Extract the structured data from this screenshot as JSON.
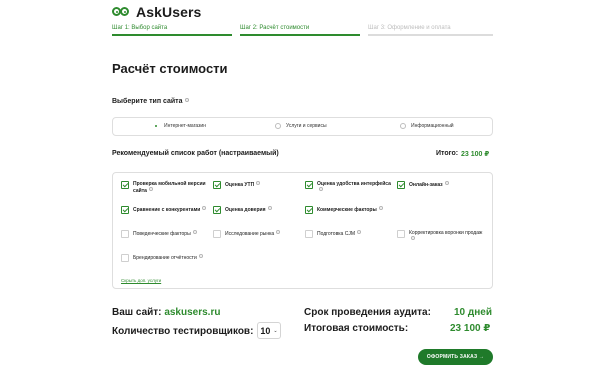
{
  "brand": {
    "name": "AskUsers",
    "accent": "#2e8b2e"
  },
  "steps": [
    {
      "label": "Шаг 1: Выбор сайта",
      "state": "done"
    },
    {
      "label": "Шаг 2: Расчёт стоимости",
      "state": "active"
    },
    {
      "label": "Шаг 3: Оформление и оплата",
      "state": "inactive"
    }
  ],
  "page_title": "Расчёт стоимости",
  "site_type": {
    "label": "Выберите тип сайта",
    "options": [
      {
        "label": "Интернет-магазин",
        "selected": true
      },
      {
        "label": "Услуги и сервисы",
        "selected": false
      },
      {
        "label": "Информационный",
        "selected": false
      }
    ]
  },
  "works": {
    "title": "Рекомендуемый список работ (настраиваемый)",
    "total_label": "Итого:",
    "total_value": "23 100 ₽",
    "items": [
      {
        "label": "Проверка мобильной версии сайта",
        "checked": true,
        "info": true
      },
      {
        "label": "Оценка УТП",
        "checked": true,
        "info": true
      },
      {
        "label": "Оценка удобства интерфейса",
        "checked": true,
        "info": true
      },
      {
        "label": "Онлайн-заказ",
        "checked": true,
        "info": true
      },
      {
        "label": "Сравнение с конкурентами",
        "checked": true,
        "info": true
      },
      {
        "label": "Оценка доверия",
        "checked": true,
        "info": true
      },
      {
        "label": "Коммерческие факторы",
        "checked": true,
        "info": true
      },
      {
        "label": "Поведенческие факторы",
        "checked": false,
        "info": true
      },
      {
        "label": "Исследование рынка",
        "checked": false,
        "info": true
      },
      {
        "label": "Подготовка CJM",
        "checked": false,
        "info": true
      },
      {
        "label": "Корректировка воронки продаж",
        "checked": false,
        "info": true
      },
      {
        "label": "Брендирование отчётности",
        "checked": false,
        "info": true
      }
    ],
    "hide_link": "Скрыть доп. услуги"
  },
  "summary": {
    "site_label": "Ваш сайт:",
    "site_value": "askusers.ru",
    "testers_label": "Количество тестировщиков:",
    "testers_value": "10",
    "duration_label": "Срок проведения аудита:",
    "duration_value": "10 дней",
    "cost_label": "Итоговая стоимость:",
    "cost_value": "23 100 ₽"
  },
  "order_button": "ОФОРМИТЬ ЗАКАЗ →"
}
